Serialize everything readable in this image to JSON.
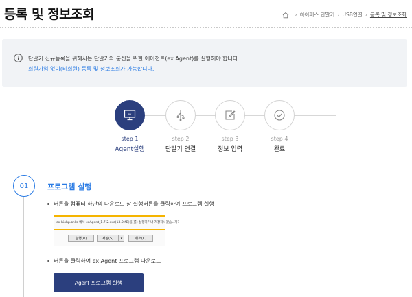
{
  "header": {
    "title": "등록 및 정보조회",
    "breadcrumb": [
      "하이패스 단말기",
      "USB연결",
      "등록 및 정보조회"
    ]
  },
  "notice": {
    "line1": "단말기 신규등록을 위해서는 단말기와 통신을 위한 에이전트(ex Agent)를 실행해야 합니다.",
    "line2": "회원가입 없이(비회원) 등록 및 정보조회가 가능합니다."
  },
  "steps": [
    {
      "num": "step 1",
      "label": "Agent실행",
      "icon": "monitor-icon",
      "active": true
    },
    {
      "num": "step 2",
      "label": "단말기 연결",
      "icon": "usb-icon",
      "active": false
    },
    {
      "num": "step 3",
      "label": "정보 입력",
      "icon": "edit-icon",
      "active": false
    },
    {
      "num": "step 4",
      "label": "완료",
      "icon": "check-icon",
      "active": false
    }
  ],
  "section": {
    "number": "01",
    "title": "프로그램 실행",
    "bullet1": "버튼을 컴퓨터 하단의 다운로드 창 실행버튼을 클릭하여 프로그램 실행",
    "bullet2": "버튼을 클릭하여 ex Agent 프로그램 다운로드"
  },
  "download_bar": {
    "text": "ex-hiohp.or.kr 에서 exAgent_1.7.2.exe(13.0MB)을(를) 실행하거나 저장하시겠습니까?",
    "run": "실행(R)",
    "save": "저장(S)",
    "dropdown": "▾",
    "cancel": "취소(C)"
  },
  "agent_button": "Agent 프로그램 실행",
  "colors": {
    "primary": "#2b3f7e",
    "accent": "#2a7be4",
    "notice_bg": "#f1f3f6",
    "download_bar": "#f5b400"
  }
}
